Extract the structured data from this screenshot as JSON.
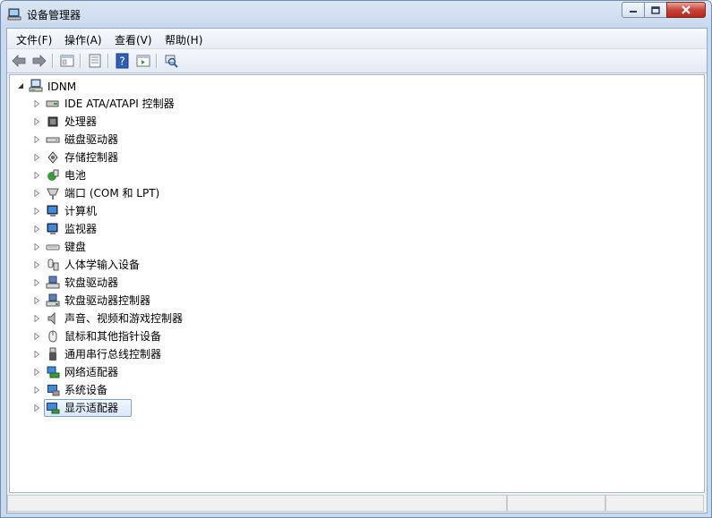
{
  "window": {
    "title": "设备管理器"
  },
  "menu": [
    {
      "label": "文件(F)"
    },
    {
      "label": "操作(A)"
    },
    {
      "label": "查看(V)"
    },
    {
      "label": "帮助(H)"
    }
  ],
  "toolbar": {
    "icons": [
      "back-icon",
      "forward-icon",
      "show-hide-tree-icon",
      "properties-icon",
      "help-icon",
      "action-pane-icon",
      "scan-hardware-icon"
    ]
  },
  "tree": {
    "root": {
      "label": "IDNM",
      "icon": "computer-icon",
      "expanded": true
    },
    "items": [
      {
        "label": "IDE ATA/ATAPI 控制器",
        "icon": "ide-controller-icon"
      },
      {
        "label": "处理器",
        "icon": "processor-icon"
      },
      {
        "label": "磁盘驱动器",
        "icon": "disk-drive-icon"
      },
      {
        "label": "存储控制器",
        "icon": "storage-controller-icon"
      },
      {
        "label": "电池",
        "icon": "battery-icon"
      },
      {
        "label": "端口 (COM 和 LPT)",
        "icon": "port-icon"
      },
      {
        "label": "计算机",
        "icon": "computer-monitor-icon"
      },
      {
        "label": "监视器",
        "icon": "monitor-icon"
      },
      {
        "label": "键盘",
        "icon": "keyboard-icon"
      },
      {
        "label": "人体学输入设备",
        "icon": "hid-icon"
      },
      {
        "label": "软盘驱动器",
        "icon": "floppy-drive-icon"
      },
      {
        "label": "软盘驱动器控制器",
        "icon": "floppy-controller-icon"
      },
      {
        "label": "声音、视频和游戏控制器",
        "icon": "sound-icon"
      },
      {
        "label": "鼠标和其他指针设备",
        "icon": "mouse-icon"
      },
      {
        "label": "通用串行总线控制器",
        "icon": "usb-icon"
      },
      {
        "label": "网络适配器",
        "icon": "network-adapter-icon"
      },
      {
        "label": "系统设备",
        "icon": "system-device-icon"
      },
      {
        "label": "显示适配器",
        "icon": "display-adapter-icon",
        "selected": true
      }
    ]
  },
  "colors": {
    "selection": "#d8e8fa",
    "selection_border": "#7da2ce",
    "title_bg": "#c9d9ee"
  }
}
